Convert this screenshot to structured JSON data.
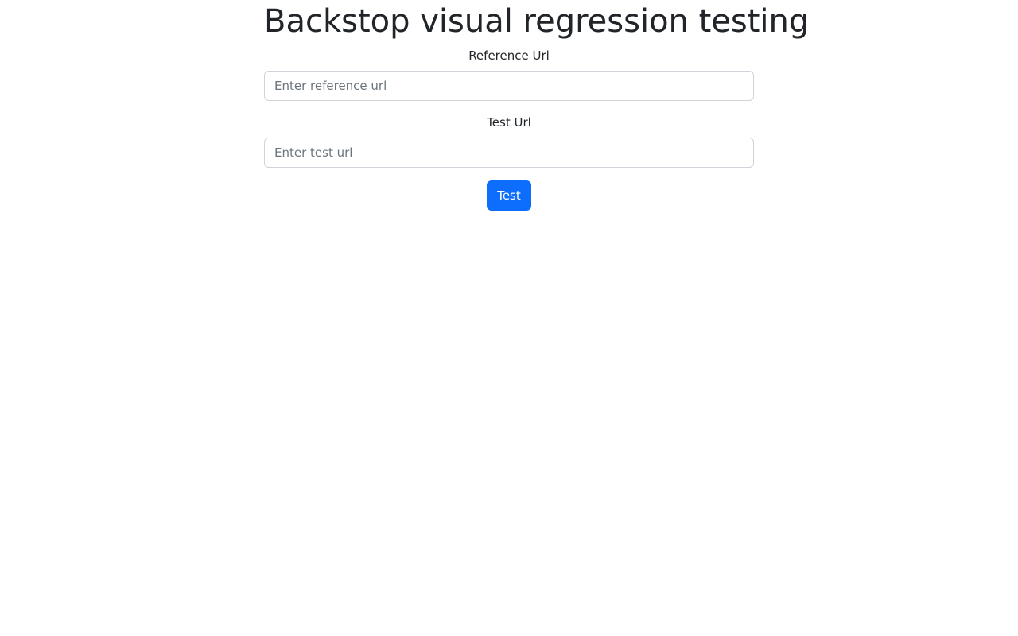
{
  "page": {
    "title": "Backstop visual regression testing"
  },
  "form": {
    "reference_label": "Reference Url",
    "reference_placeholder": "Enter reference url",
    "reference_value": "",
    "test_label": "Test Url",
    "test_placeholder": "Enter test url",
    "test_value": "",
    "submit_label": "Test"
  },
  "colors": {
    "primary": "#0d6efd",
    "text": "#212529",
    "border": "#ced4da",
    "placeholder": "#6c757d",
    "background": "#ffffff"
  }
}
